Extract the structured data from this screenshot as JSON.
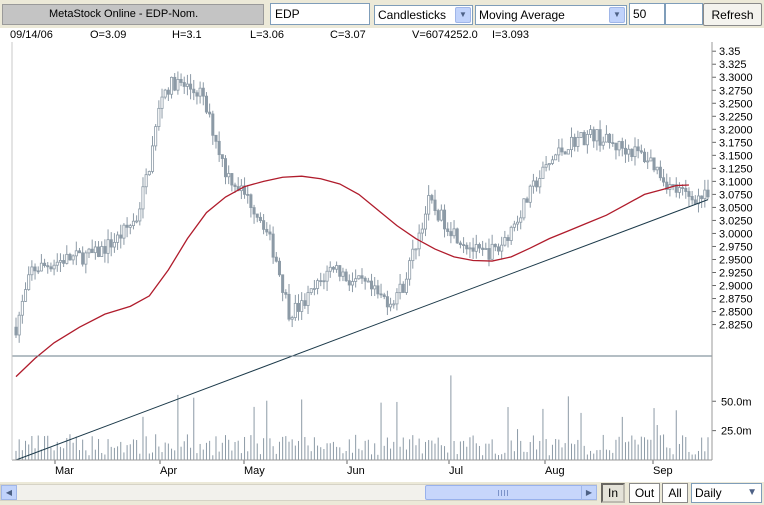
{
  "toolbar": {
    "title": "MetaStock Online - EDP-Nom.",
    "symbol": "EDP",
    "chart_style": "Candlesticks",
    "indicator": "Moving Average",
    "period": "50",
    "refresh_label": "Refresh"
  },
  "ohlc": {
    "date": "09/14/06",
    "open": "O=3.09",
    "high": "H=3.1",
    "low": "L=3.06",
    "close": "C=3.07",
    "volume": "V=6074252.0",
    "indicator_value": "I=3.093"
  },
  "bottom": {
    "zoom_in_label": "In",
    "zoom_out_label": "Out",
    "zoom_all_label": "All",
    "interval": "Daily"
  },
  "colors": {
    "candle": "#8c9aa6",
    "moving_average": "#b01c2c",
    "trendline": "#1c3a4a",
    "grid": "#d8d8d8"
  },
  "chart_data": {
    "type": "candlestick",
    "price_axis": {
      "ticks": [
        "3.35",
        "3.325",
        "3.3000",
        "3.2750",
        "3.2500",
        "3.2250",
        "3.2000",
        "3.1750",
        "3.1500",
        "3.1250",
        "3.1000",
        "3.0750",
        "3.0500",
        "3.0250",
        "3.0000",
        "2.9750",
        "2.9500",
        "2.9250",
        "2.9000",
        "2.8750",
        "2.8500",
        "2.8250"
      ],
      "min": 2.78,
      "max": 3.36
    },
    "volume_axis": {
      "ticks": [
        "50.0m",
        "25.0m"
      ],
      "max": 80
    },
    "months": [
      "Mar",
      "Apr",
      "May",
      "Jun",
      "Jul",
      "Aug",
      "Sep"
    ],
    "moving_average": [
      [
        0,
        2.725
      ],
      [
        6,
        2.76
      ],
      [
        12,
        2.79
      ],
      [
        20,
        2.82
      ],
      [
        28,
        2.845
      ],
      [
        36,
        2.86
      ],
      [
        42,
        2.88
      ],
      [
        48,
        2.93
      ],
      [
        54,
        2.99
      ],
      [
        60,
        3.04
      ],
      [
        66,
        3.07
      ],
      [
        72,
        3.09
      ],
      [
        78,
        3.1
      ],
      [
        84,
        3.108
      ],
      [
        90,
        3.11
      ],
      [
        96,
        3.105
      ],
      [
        102,
        3.095
      ],
      [
        108,
        3.075
      ],
      [
        114,
        3.045
      ],
      [
        120,
        3.015
      ],
      [
        126,
        2.99
      ],
      [
        132,
        2.97
      ],
      [
        138,
        2.955
      ],
      [
        144,
        2.948
      ],
      [
        150,
        2.947
      ],
      [
        156,
        2.955
      ],
      [
        162,
        2.972
      ],
      [
        168,
        2.99
      ],
      [
        174,
        3.005
      ],
      [
        180,
        3.02
      ],
      [
        186,
        3.035
      ],
      [
        192,
        3.055
      ],
      [
        198,
        3.075
      ],
      [
        204,
        3.085
      ],
      [
        208,
        3.092
      ],
      [
        212,
        3.093
      ]
    ],
    "trendline": {
      "from": [
        0,
        2.66
      ],
      "to": [
        218,
        3.065
      ]
    }
  }
}
